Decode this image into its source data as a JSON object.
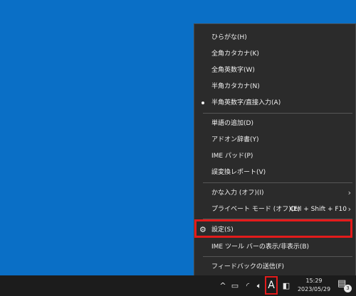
{
  "menu": {
    "items": [
      {
        "label": "ひらがな(H)"
      },
      {
        "label": "全角カタカナ(K)"
      },
      {
        "label": "全角英数字(W)"
      },
      {
        "label": "半角カタカナ(N)"
      },
      {
        "label": "半角英数字/直接入力(A)",
        "selected": true
      },
      {
        "label": "単語の追加(D)"
      },
      {
        "label": "アドオン辞書(Y)"
      },
      {
        "label": "IME パッド(P)"
      },
      {
        "label": "誤変換レポート(V)"
      },
      {
        "label": "かな入力 (オフ)(I)"
      },
      {
        "label": "プライベート モード (オフ)(E)",
        "shortcut": "Ctrl + Shift + F10"
      },
      {
        "label": "設定(S)"
      },
      {
        "label": "IME ツール バーの表示/非表示(B)"
      },
      {
        "label": "フィードバックの送信(F)"
      }
    ]
  },
  "taskbar": {
    "ime_mode": "A",
    "time": "15:29",
    "date": "2023/05/29",
    "notification_count": "3"
  },
  "colors": {
    "desktop": "#0a6fc6",
    "menu_bg": "#2b2b2b",
    "highlight": "#e31b1b",
    "taskbar": "#1c1c1c"
  }
}
